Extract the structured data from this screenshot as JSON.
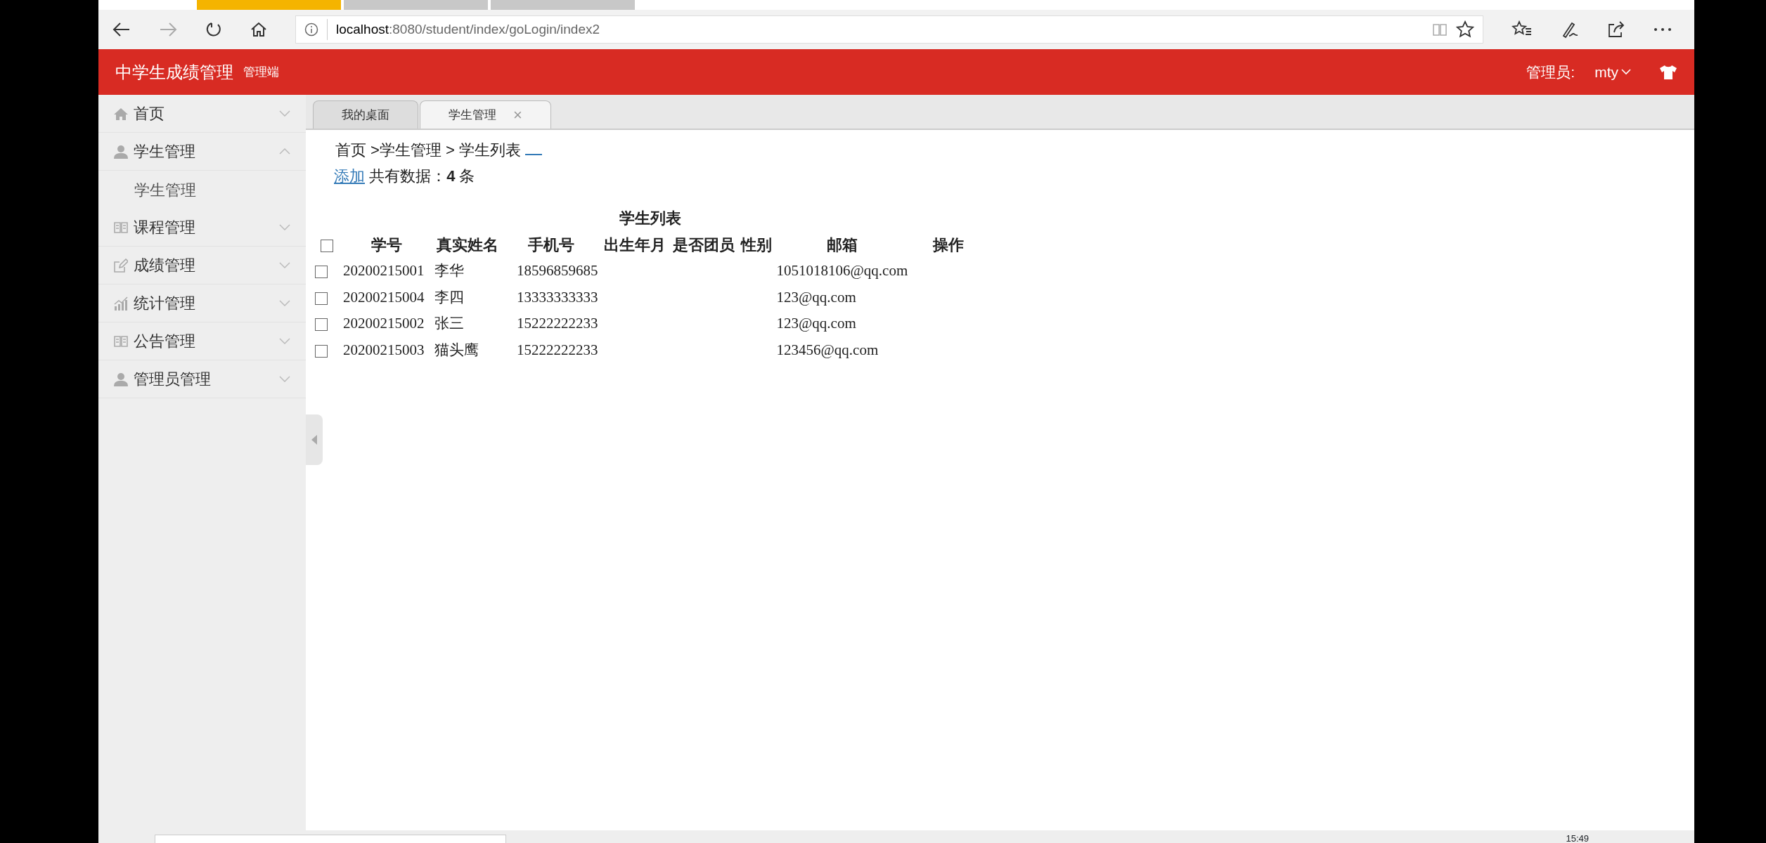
{
  "browser": {
    "url_host": "localhost",
    "url_path": ":8080/student/index/goLogin/index2"
  },
  "header": {
    "title": "中学生成绩管理",
    "subtitle": "管理端",
    "user_label": "管理员:",
    "user": "mty"
  },
  "sidebar": {
    "items": [
      {
        "label": "首页",
        "expanded": false
      },
      {
        "label": "学生管理",
        "expanded": true,
        "children": [
          {
            "label": "学生管理"
          }
        ]
      },
      {
        "label": "课程管理",
        "expanded": false
      },
      {
        "label": "成绩管理",
        "expanded": false
      },
      {
        "label": "统计管理",
        "expanded": false
      },
      {
        "label": "公告管理",
        "expanded": false
      },
      {
        "label": "管理员管理",
        "expanded": false
      }
    ]
  },
  "tabs": [
    {
      "label": "我的桌面",
      "selected": false
    },
    {
      "label": "学生管理",
      "selected": true,
      "close": "×"
    }
  ],
  "breadcrumb": "首页 >学生管理 > 学生列表",
  "add_link": "添加",
  "count_text": "共有数据：**4** 条",
  "browser_tabs": [
    {
      "selected": true
    },
    {
      "selected": false
    },
    {
      "selected": false
    }
  ],
  "table": {
    "title": "学生列表",
    "select_all_checked": false,
    "columns": [
      "学号",
      "真实姓名",
      "手机号",
      "出生年月",
      "是否团员",
      "性别",
      "邮箱",
      "操作"
    ],
    "rows": [
      {
        "checked": false,
        "cells": [
          "20200215001",
          "李华",
          "18596859685",
          "",
          "",
          "",
          "1051018106@qq.com",
          ""
        ]
      },
      {
        "checked": false,
        "cells": [
          "20200215004",
          "李四",
          "13333333333",
          "",
          "",
          "",
          "123@qq.com",
          ""
        ]
      },
      {
        "checked": false,
        "cells": [
          "20200215002",
          "张三",
          "15222222233",
          "",
          "",
          "",
          "123@qq.com",
          ""
        ]
      },
      {
        "checked": false,
        "cells": [
          "20200215003",
          "猫头鹰",
          "15222222233",
          "",
          "",
          "",
          "123456@qq.com",
          ""
        ]
      }
    ]
  },
  "taskbar": {
    "time": "15:49"
  }
}
